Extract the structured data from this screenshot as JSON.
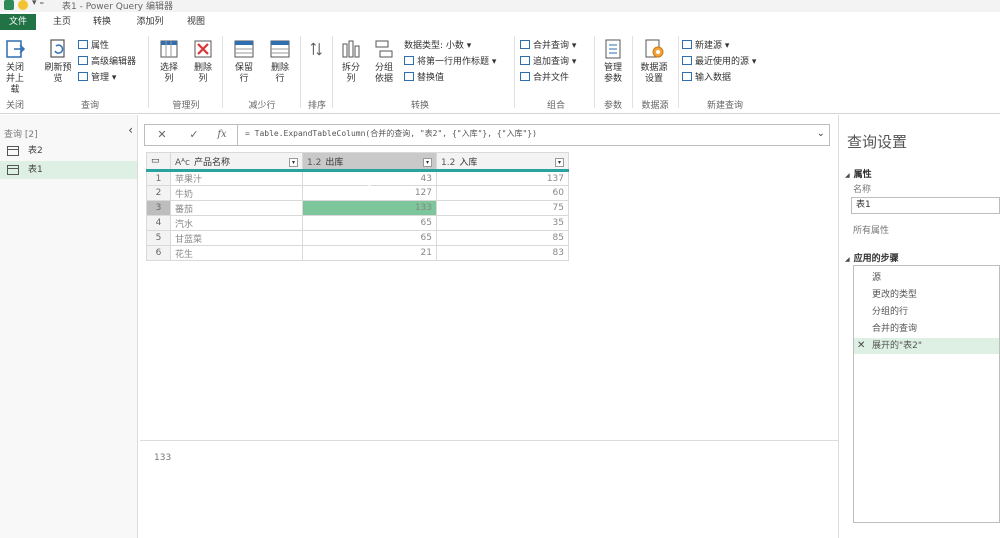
{
  "titlebar": {
    "title": "表1 - Power Query 编辑器"
  },
  "tabs": [
    {
      "label": "文件",
      "active": true
    },
    {
      "label": "主页",
      "active": false
    },
    {
      "label": "转换",
      "active": false
    },
    {
      "label": "添加列",
      "active": false
    },
    {
      "label": "视图",
      "active": false
    }
  ],
  "ribbon": {
    "close_upload": "关闭并上载",
    "refresh_preview": "刷新预览",
    "properties": "属性",
    "advanced_editor": "高级编辑器",
    "manage": "管理",
    "choose_columns": "选择列",
    "remove_columns": "删除列",
    "keep_rows": "保留行",
    "remove_rows": "删除行",
    "split_column": "拆分列",
    "group_by": "分组依据",
    "data_type": "数据类型: 小数",
    "first_row_header": "将第一行用作标题",
    "replace_values": "替换值",
    "merge_queries": "合并查询",
    "append_queries": "追加查询",
    "combine_files": "合并文件",
    "manage_params": "管理参数",
    "ds_settings": "数据源设置",
    "new_source": "新建源",
    "recent_sources": "最近使用的源",
    "enter_data": "输入数据",
    "groups": {
      "close": "关闭",
      "query": "查询",
      "manage_cols": "管理列",
      "reduce_rows": "减少行",
      "sort": "排序",
      "transform": "转换",
      "combine": "组合",
      "params": "参数",
      "datasource": "数据源",
      "new_query": "新建查询"
    }
  },
  "left": {
    "header": "查询 [2]",
    "queries": [
      {
        "name": "表2",
        "selected": false
      },
      {
        "name": "表1",
        "selected": true
      }
    ]
  },
  "formula": {
    "cancel": "✕",
    "confirm": "✓",
    "fx": "fx",
    "text": "= Table.ExpandTableColumn(合并的查询, \"表2\", {\"入库\"}, {\"入库\"})"
  },
  "grid": {
    "columns": [
      {
        "type": "Aᴬᴄ",
        "name": "产品名称"
      },
      {
        "type": "1.2",
        "name": "出库"
      },
      {
        "type": "1.2",
        "name": "入库"
      }
    ],
    "rows": [
      {
        "n": "1",
        "name": "苹果汁",
        "out": "43",
        "in": "137"
      },
      {
        "n": "2",
        "name": "牛奶",
        "out": "127",
        "in": "60"
      },
      {
        "n": "3",
        "name": "蕃茄",
        "out": "133",
        "in": "75"
      },
      {
        "n": "4",
        "name": "汽水",
        "out": "65",
        "in": "35"
      },
      {
        "n": "5",
        "name": "甘蓝菜",
        "out": "65",
        "in": "85"
      },
      {
        "n": "6",
        "name": "花生",
        "out": "21",
        "in": "83"
      }
    ]
  },
  "bottom": {
    "value": "133"
  },
  "right": {
    "title": "查询设置",
    "props_header": "属性",
    "name_label": "名称",
    "name_value": "表1",
    "all_props": "所有属性",
    "steps_header": "应用的步骤",
    "steps": [
      {
        "label": "源",
        "selected": false
      },
      {
        "label": "更改的类型",
        "selected": false
      },
      {
        "label": "分组的行",
        "selected": false
      },
      {
        "label": "合并的查询",
        "selected": false
      },
      {
        "label": "展开的\"表2\"",
        "selected": true
      }
    ]
  },
  "colors": {
    "accent": "#217346",
    "header_underline": "#2aa3a0",
    "selected_cell": "#7dc59a"
  }
}
